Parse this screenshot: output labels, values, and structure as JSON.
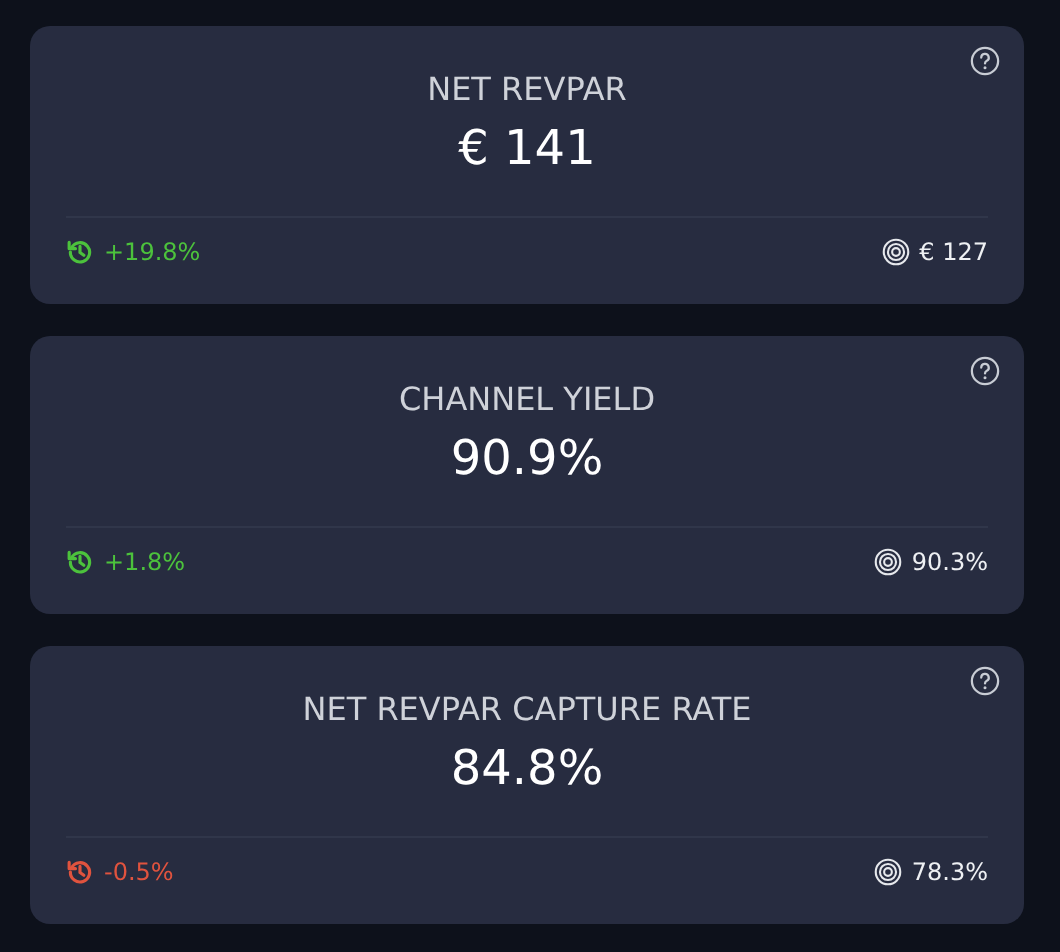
{
  "cards": [
    {
      "title": "NET REVPAR",
      "value": "€ 141",
      "change": "+19.8%",
      "color": "#4cc23c",
      "target": "€ 127"
    },
    {
      "title": "CHANNEL YIELD",
      "value": "90.9%",
      "change": "+1.8%",
      "color": "#4cc23c",
      "target": "90.3%"
    },
    {
      "title": "NET REVPAR CAPTURE RATE",
      "value": "84.8%",
      "change": "-0.5%",
      "color": "#e0533e",
      "target": "78.3%"
    }
  ]
}
